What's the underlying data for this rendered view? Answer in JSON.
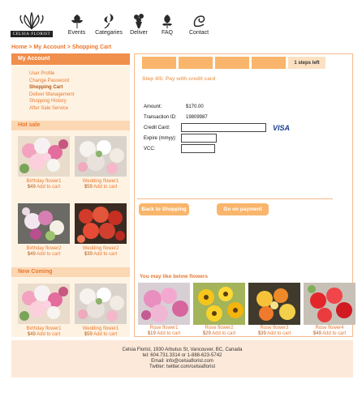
{
  "logo": {
    "text": "CELSIA·FLORIST"
  },
  "nav": [
    {
      "label": "Events",
      "icon": "flower-icon"
    },
    {
      "label": "Categaries",
      "icon": "lily-icon"
    },
    {
      "label": "Deliver",
      "icon": "bouquet-icon"
    },
    {
      "label": "FAQ",
      "icon": "flower-bud-icon"
    },
    {
      "label": "Contact",
      "icon": "swirl-flower-icon"
    }
  ],
  "breadcrumb": "Home > My Account > Shopping Cart",
  "sidebar": {
    "account_title": "My Account",
    "account_menu": [
      "User Profile",
      "Change Password",
      "Shopping Cart",
      "Deliver Management",
      "Shopping History",
      "After Sale Service"
    ],
    "active_index": 2,
    "hot_sale": {
      "title": "Hot sale",
      "items": [
        {
          "name": "Birthday flower1",
          "price": "$49",
          "cart": "Add to cart"
        },
        {
          "name": "Wedding flower1",
          "price": "$59",
          "cart": "Add to cart"
        },
        {
          "name": "Birthday flower2",
          "price": "$49",
          "cart": "Add to cart"
        },
        {
          "name": "Wedding flower2",
          "price": "$39",
          "cart": "Add to cart"
        }
      ]
    },
    "new_coming": {
      "title": "New Coming",
      "items": [
        {
          "name": "Birthday flower1",
          "price": "$49",
          "cart": "Add to cart"
        },
        {
          "name": "Wedding flower1",
          "price": "$59",
          "cart": "Add to cart"
        }
      ]
    }
  },
  "checkout": {
    "steps_left": "1 steps left",
    "steps_done": 4,
    "step_title": "Step 4/5: Pay with credit card",
    "amount_label": "Amount:",
    "amount_value": "$170.00",
    "transaction_label": "Transaction ID:",
    "transaction_value": "19809987",
    "card_label": "Credit Card:",
    "card_value": "",
    "card_brand": "VISA",
    "expire_label": "Expire (mmyy):",
    "expire_value": "",
    "vcc_label": "VCC:",
    "vcc_value": "",
    "back_button": "Back to Shopping",
    "pay_button": "Go on payment"
  },
  "suggestions": {
    "title": "You may like below flowers",
    "items": [
      {
        "name": "Rose flower1",
        "price": "$19",
        "cart": "Add to cart"
      },
      {
        "name": "Rose flower2",
        "price": "$29",
        "cart": "Add to cart"
      },
      {
        "name": "Rose flower3",
        "price": "$39",
        "cart": "Add to cart"
      },
      {
        "name": "Rose flower4",
        "price": "$49",
        "cart": "Add to cart"
      }
    ]
  },
  "footer": {
    "address": "Celsia Florist, 1930 Arbutus St, Vancouver, BC, Canada",
    "tel": "tel: 604.731.3314  or 1-888-623-5742",
    "email": "Email: info@celsiaflorist.com",
    "twitter": "Twitter: twitter.com/celsiaflorist"
  },
  "colors": {
    "accent": "#f08e4c",
    "accent_light": "#f9b56b",
    "panel": "#fef3e3",
    "footer": "#fde9d9"
  }
}
